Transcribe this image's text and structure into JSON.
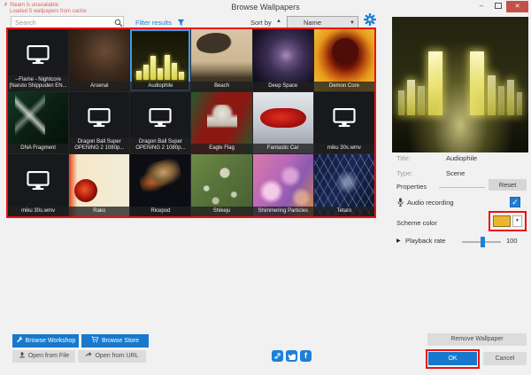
{
  "window": {
    "title": "Browse Wallpapers"
  },
  "status": {
    "line1": "Steam is unavailable",
    "line2": "Loaded 5 wallpapers from cache"
  },
  "toolbar": {
    "search_placeholder": "Search",
    "filter_label": "Filter results",
    "sort_label": "Sort by",
    "sort_value": "Name"
  },
  "icons": {
    "sort_asc": "▲",
    "dropdown": "▼",
    "collapse": "▶",
    "check": "✓",
    "warning": "✗",
    "minimize": "–",
    "close": "✕",
    "facebook": "f"
  },
  "grid": {
    "items": [
      {
        "label": "--Flame - Nightcore [Naruto Shippuden EN...",
        "selected": false
      },
      {
        "label": "Arsenal",
        "selected": false
      },
      {
        "label": "Audiophile",
        "selected": true
      },
      {
        "label": "Beach",
        "selected": false
      },
      {
        "label": "Deep Space",
        "selected": false
      },
      {
        "label": "Demon Core",
        "selected": false
      },
      {
        "label": "DNA Fragment",
        "selected": false
      },
      {
        "label": "Dragon Ball Super OPENING 2 1080p...",
        "selected": false
      },
      {
        "label": "Dragon Ball Super OPENING 2 1080p...",
        "selected": false
      },
      {
        "label": "Eagle Flag",
        "selected": false
      },
      {
        "label": "Fantastic Car",
        "selected": false
      },
      {
        "label": "miku 30s.wmv",
        "selected": false
      },
      {
        "label": "miku 30s.wmv",
        "selected": false
      },
      {
        "label": "Rako",
        "selected": false
      },
      {
        "label": "Ricepod",
        "selected": false
      },
      {
        "label": "Shikeju",
        "selected": false
      },
      {
        "label": "Shimmering Particles",
        "selected": false
      },
      {
        "label": "Tetaro",
        "selected": false
      }
    ]
  },
  "details": {
    "title_label": "Title:",
    "title_value": "Audiophile",
    "type_label": "Type:",
    "type_value": "Scene",
    "properties_label": "Properties",
    "reset_label": "Reset",
    "audio_recording_label": "Audio recording",
    "scheme_color_label": "Scheme color",
    "scheme_color_value": "#eab62f",
    "playback_rate_label": "Playback rate",
    "playback_rate_value": "100"
  },
  "footer": {
    "browse_workshop": "Browse Workshop",
    "browse_store": "Browse Store",
    "open_from_file": "Open from File",
    "open_from_url": "Open from URL",
    "remove_wallpaper": "Remove Wallpaper",
    "ok": "OK",
    "cancel": "Cancel"
  },
  "colors": {
    "accent": "#1d80d7",
    "annotation": "#ee1111",
    "selected_border": "#3f9bea",
    "scheme_color": "#eab62f"
  }
}
